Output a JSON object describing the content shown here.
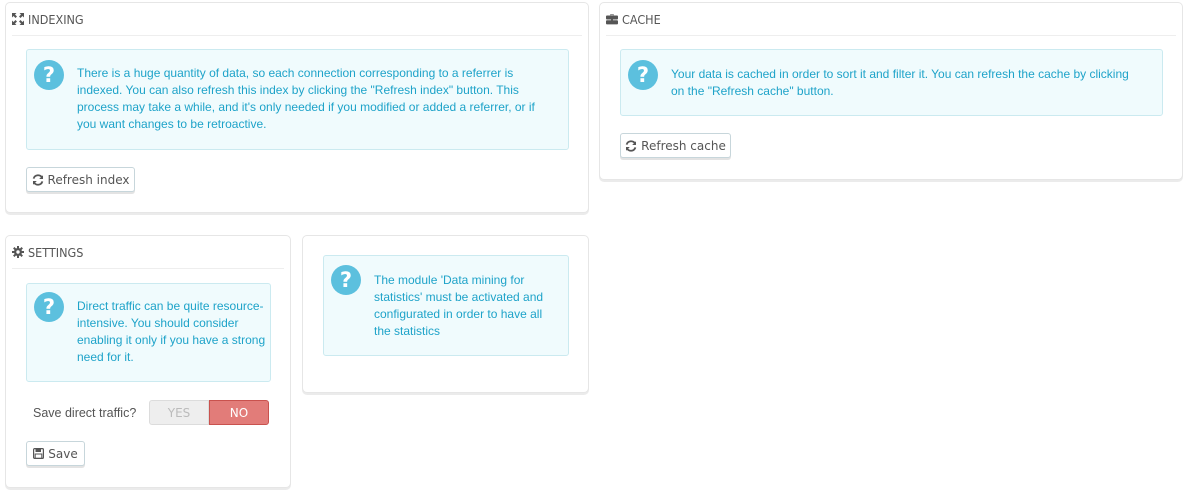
{
  "indexing": {
    "title": "INDEXING",
    "icon": "expand-icon",
    "alert_text": "There is a huge quantity of data, so each connection corresponding to a referrer is indexed. You can also refresh this index by clicking the \"Refresh index\" button. This process may take a while, and it's only needed if you modified or added a referrer, or if you want changes to be retroactive.",
    "button_label": "Refresh index"
  },
  "cache": {
    "title": "CACHE",
    "icon": "briefcase-icon",
    "alert_text": "Your data is cached in order to sort it and filter it. You can refresh the cache by clicking on the \"Refresh cache\" button.",
    "button_label": "Refresh cache"
  },
  "settings": {
    "title": "SETTINGS",
    "icon": "gear-icon",
    "alert_text": "Direct traffic can be quite resource-intensive. You should consider enabling it only if you have a strong need for it.",
    "field_label": "Save direct traffic?",
    "toggle": {
      "yes_label": "YES",
      "no_label": "NO",
      "selected": "NO"
    },
    "save_label": "Save"
  },
  "module_notice": {
    "alert_text": "The module 'Data mining for statistics' must be activated and configurated in order to have all the statistics"
  },
  "colors": {
    "alert_bg": "#f0fbfd",
    "alert_text": "#1ea3c9",
    "alert_icon": "#5cc0de",
    "toggle_no": "#e27c79"
  }
}
